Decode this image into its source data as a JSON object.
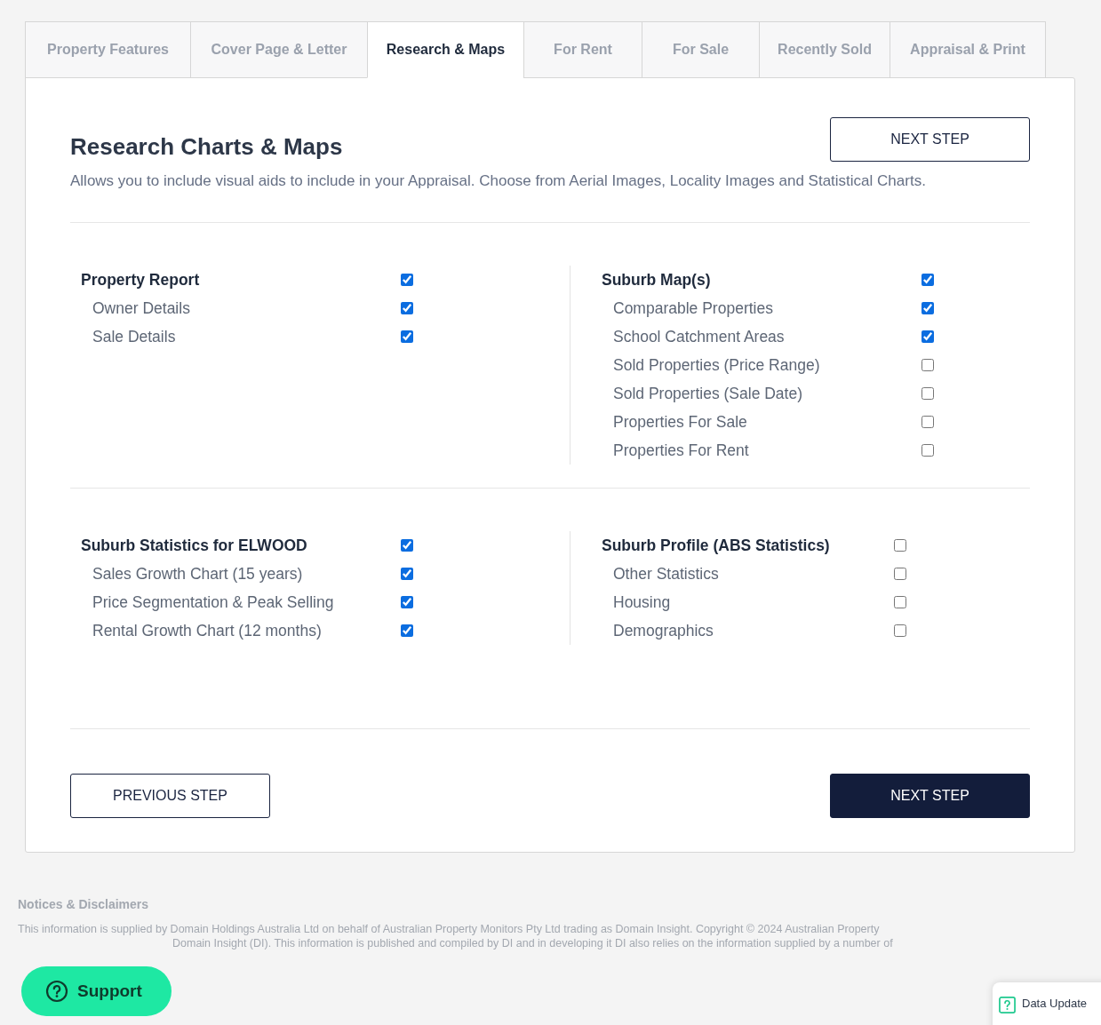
{
  "tabs": [
    {
      "label": "Property Features",
      "selected": false
    },
    {
      "label": "Cover Page & Letter",
      "selected": false
    },
    {
      "label": "Research & Maps",
      "selected": true
    },
    {
      "label": "For Rent",
      "selected": false
    },
    {
      "label": "For Sale",
      "selected": false
    },
    {
      "label": "Recently Sold",
      "selected": false
    },
    {
      "label": "Appraisal & Print",
      "selected": false
    }
  ],
  "title": "Research Charts & Maps",
  "top_button": "NEXT STEP",
  "description": "Allows you to include visual aids to include in your Appraisal. Choose from Aerial Images, Locality Images and Statistical Charts.",
  "sections": [
    {
      "groups": [
        {
          "title": "Property Report",
          "checked": true,
          "items": [
            {
              "label": "Owner Details",
              "checked": true
            },
            {
              "label": "Sale Details",
              "checked": true
            }
          ]
        },
        {
          "title": "Suburb Map(s)",
          "checked": true,
          "items": [
            {
              "label": "Comparable Properties",
              "checked": true
            },
            {
              "label": "School Catchment Areas",
              "checked": true
            },
            {
              "label": "Sold Properties (Price Range)",
              "checked": false
            },
            {
              "label": "Sold Properties (Sale Date)",
              "checked": false
            },
            {
              "label": "Properties For Sale",
              "checked": false
            },
            {
              "label": "Properties For Rent",
              "checked": false
            }
          ]
        }
      ]
    },
    {
      "groups": [
        {
          "title": "Suburb Statistics for ELWOOD",
          "checked": true,
          "items": [
            {
              "label": "Sales Growth Chart (15 years)",
              "checked": true
            },
            {
              "label": "Price Segmentation & Peak Selling",
              "checked": true
            },
            {
              "label": "Rental Growth Chart (12 months)",
              "checked": true
            }
          ]
        },
        {
          "title": "Suburb Profile (ABS Statistics)",
          "checked": false,
          "items": [
            {
              "label": "Other Statistics",
              "checked": false
            },
            {
              "label": "Housing",
              "checked": false
            },
            {
              "label": "Demographics",
              "checked": false
            }
          ]
        }
      ]
    }
  ],
  "previous_button": "PREVIOUS STEP",
  "next_button": "NEXT STEP",
  "notices": {
    "title": "Notices & Disclaimers",
    "line_1": "This information is supplied by Domain Holdings Australia Ltd on behalf of Australian Property Monitors Pty Ltd trading as Domain Insight. Copyright © 2024 Australian Property",
    "line_2": "Domain Insight (DI). This information is published and compiled by DI and in developing it DI also relies on the information supplied by a number of"
  },
  "support_button": "Support",
  "data_update": "Data Update"
}
